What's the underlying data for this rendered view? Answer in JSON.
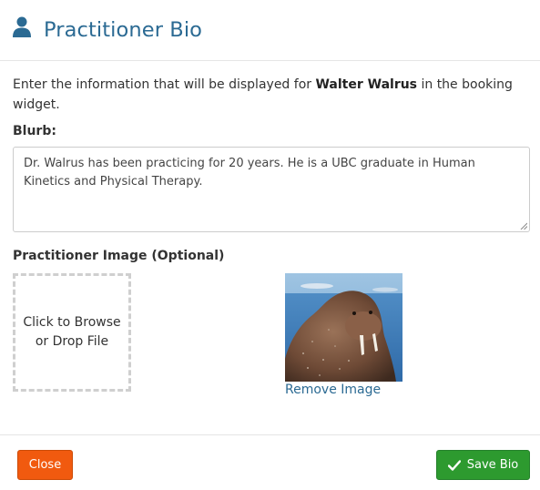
{
  "header": {
    "icon": "user-icon",
    "title": "Practitioner Bio"
  },
  "intro": {
    "before": "Enter the information that will be displayed for ",
    "name": "Walter Walrus",
    "after": " in the booking widget."
  },
  "blurb": {
    "label": "Blurb:",
    "value": "Dr. Walrus has been practicing for 20 years. He is a UBC graduate in Human Kinetics and Physical Therapy."
  },
  "image": {
    "label": "Practitioner Image (Optional)",
    "dropzone_text": "Click to Browse or Drop File",
    "remove_label": "Remove Image"
  },
  "footer": {
    "close_label": "Close",
    "save_label": "Save Bio",
    "save_icon": "check-icon"
  },
  "colors": {
    "title": "#2b6a93",
    "close_button": "#f15a0f",
    "save_button": "#2d9a2f",
    "link": "#2b6a93"
  }
}
